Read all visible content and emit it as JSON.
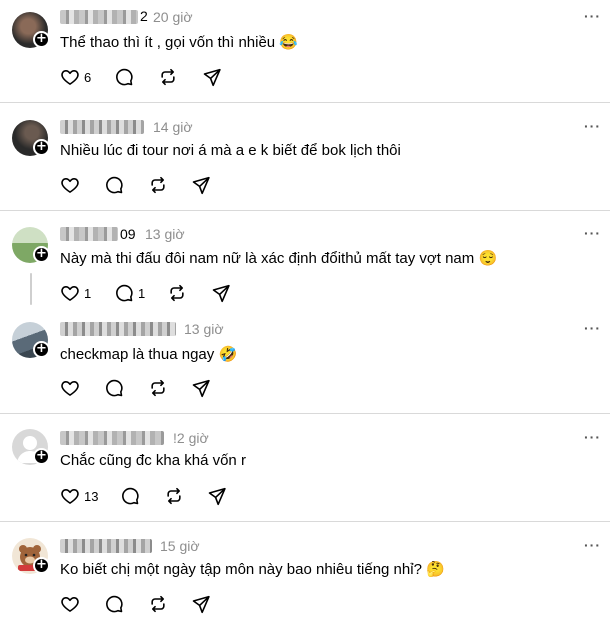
{
  "posts": [
    {
      "username": "",
      "time": "20 giờ",
      "text": "Thể thao thì ít , gọi vốn thì nhiều",
      "emoji": "😂",
      "likes": "6",
      "replies": "",
      "avatar_colors": [
        "#2b2b2b",
        "#7a5a48"
      ]
    },
    {
      "username": "",
      "time": "14 giờ",
      "text": "Nhiều lúc đi tour nơi á mà a e k biết để bok lịch thôi",
      "emoji": "",
      "likes": "",
      "replies": "",
      "avatar_colors": [
        "#2a2a2a",
        "#5c4a40"
      ]
    },
    {
      "username": "09",
      "time": "13 giờ",
      "text": "Này mà thi đấu đôi nam nữ là xác định đổithủ mất tay vợt nam",
      "emoji": "😌",
      "likes": "1",
      "replies": "1",
      "avatar_colors": [
        "#7ea865",
        "#cfe0c4"
      ]
    },
    {
      "username": "",
      "time": "13 giờ",
      "text": "checkmap là thua ngay",
      "emoji": "🤣",
      "likes": "",
      "replies": "",
      "avatar_colors": [
        "#5a6a78",
        "#c6d0d8"
      ]
    },
    {
      "username": "",
      "time": "!2 giờ",
      "text": "Chắc cũng đc kha khá vốn r",
      "emoji": "",
      "likes": "13",
      "replies": "",
      "avatar_colors": [
        "#d8d8d8",
        "#ffffff"
      ]
    },
    {
      "username": "",
      "time": "15 giờ",
      "text": "Ko biết chị một ngày tập môn này bao nhiêu tiếng nhỉ?",
      "emoji": "🤔",
      "likes": "",
      "replies": "",
      "avatar_colors": [
        "#f1e6d6",
        "#a0643a"
      ]
    }
  ],
  "icons": {
    "like": "heart-icon",
    "reply": "comment-icon",
    "repost": "repost-icon",
    "share": "send-icon",
    "more": "more-icon",
    "follow": "plus-icon"
  },
  "colors": {
    "text": "#000000",
    "muted": "#8e8e8e",
    "divider": "#d9d9d9"
  },
  "more_glyph": "···",
  "plus_glyph": "+"
}
